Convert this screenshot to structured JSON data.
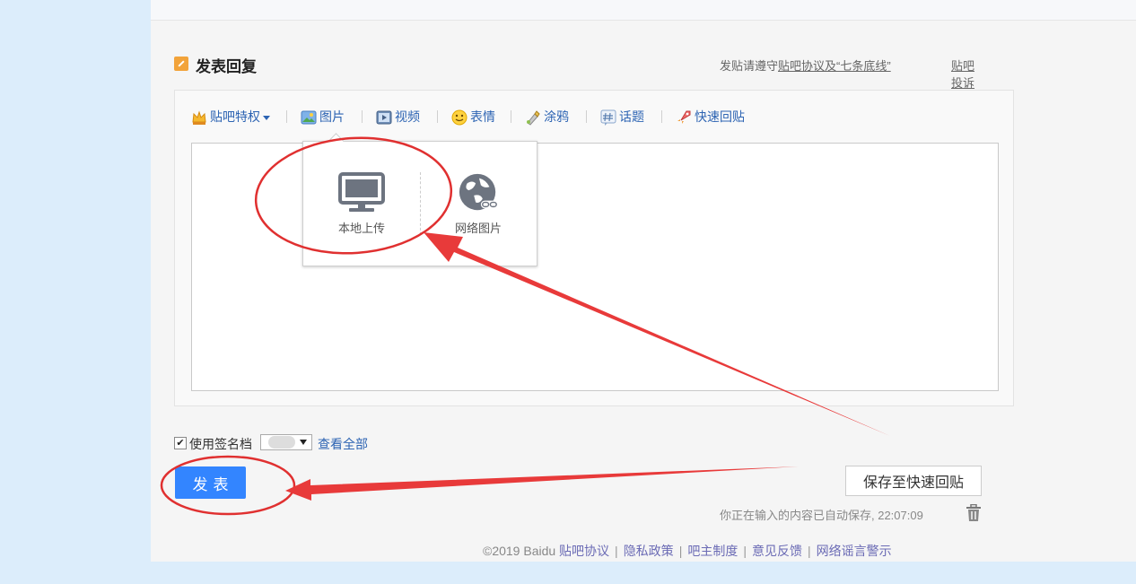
{
  "header": {
    "title": "发表回复",
    "rules_prefix": "发贴请遵守",
    "rules_link": "贴吧协议及“七条底线”",
    "complaint": "贴吧投诉"
  },
  "toolbar": {
    "privilege": "贴吧特权",
    "image": "图片",
    "video": "视频",
    "emoji": "表情",
    "doodle": "涂鸦",
    "topic": "话题",
    "quick_reply": "快速回贴"
  },
  "image_popup": {
    "local_upload": "本地上传",
    "web_image": "网络图片"
  },
  "signature": {
    "label": "使用签名档",
    "checked": true,
    "view_all": "查看全部"
  },
  "actions": {
    "submit": "发表",
    "save_quick": "保存至快速回贴",
    "autosave": "你正在输入的内容已自动保存, 22:07:09"
  },
  "footer": {
    "copyright": "©2019 Baidu",
    "links": [
      "贴吧协议",
      "隐私政策",
      "吧主制度",
      "意见反馈",
      "网络谣言警示"
    ]
  },
  "icons": {
    "header": "edit-icon",
    "privilege": "crown-icon",
    "image": "picture-icon",
    "video": "video-icon",
    "emoji": "smiley-icon",
    "doodle": "paint-brush-icon",
    "topic": "hashtag-icon",
    "quick_reply": "rocket-icon",
    "local_upload": "monitor-icon",
    "web_image": "globe-icon",
    "trash": "trash-icon"
  },
  "colors": {
    "accent": "#3385ff",
    "link": "#2d64b3",
    "annotation": "#e03030"
  }
}
